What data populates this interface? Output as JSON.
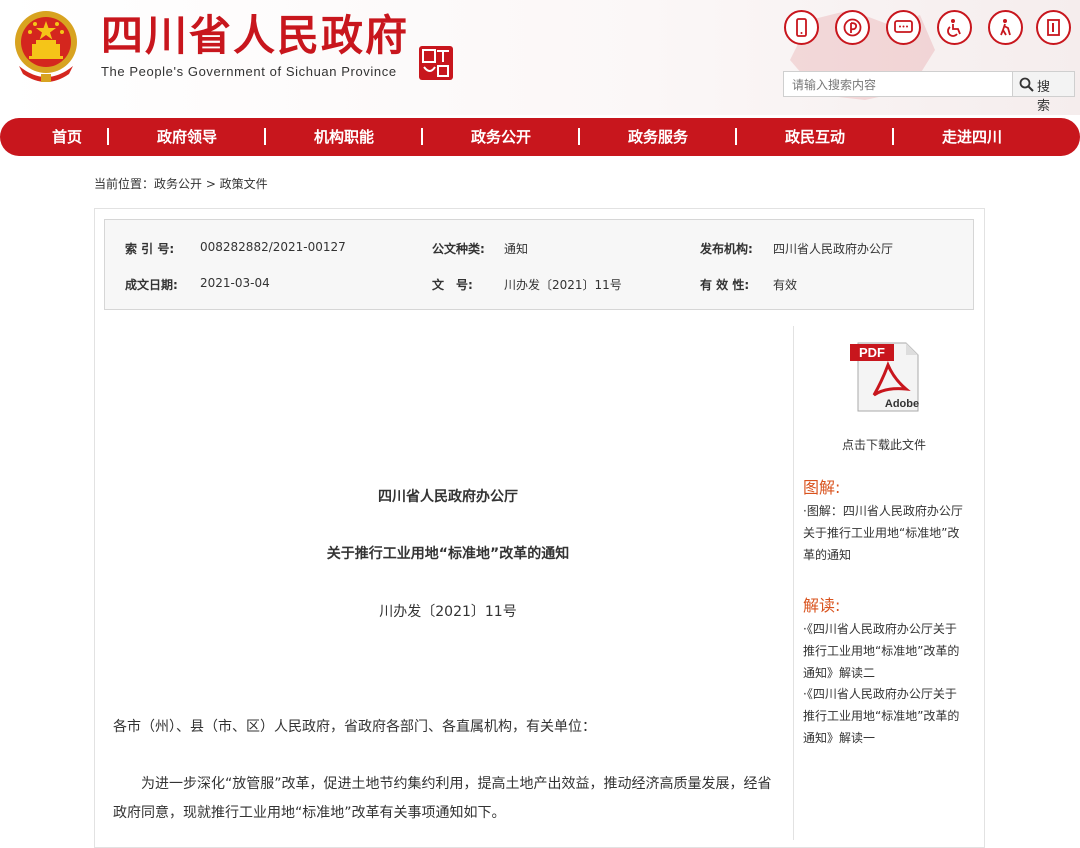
{
  "header": {
    "site_title": "四川省人民政府",
    "site_subtitle": "The People's Government of Sichuan Province",
    "emblem": "national-emblem-icon",
    "seal": "china-seal-icon",
    "tool_icons": [
      "mobile-icon",
      "pinterest-icon",
      "message-icon",
      "accessibility-icon",
      "elderly-icon",
      "exit-icon"
    ],
    "search": {
      "placeholder": "请输入搜索内容",
      "button_label": "搜 索"
    },
    "brand_color": "#c8161d"
  },
  "nav": {
    "items": [
      "首页",
      "政府领导",
      "机构职能",
      "政务公开",
      "政务服务",
      "政民互动",
      "走进四川"
    ],
    "separator": "|"
  },
  "breadcrumb": "当前位置：政务公开 > 政策文件",
  "meta": {
    "index_label": "索 引 号:",
    "index_value": "008282882/2021-00127",
    "type_label": "公文种类:",
    "type_value": "通知",
    "issuer_label": "发布机构:",
    "issuer_value": "四川省人民政府办公厅",
    "date_label": "成文日期:",
    "date_value": "2021-03-04",
    "doc_no_label": "文　号:",
    "doc_no_value": "川办发〔2021〕11号",
    "validity_label": "有 效 性:",
    "validity_value": "有效"
  },
  "sidebar": {
    "pdf_icon": "pdf-adobe-icon",
    "pdf_label": "PDF",
    "pdf_brand": "Adobe",
    "download_label": "点击下载此文件",
    "graphic_heading": "图解:",
    "graphic_link": "·图解：四川省人民政府办公厅关于推行工业用地“标准地”改革的通知",
    "interpret_heading": "解读:",
    "interpret_links": [
      "·《四川省人民政府办公厅关于推行工业用地“标准地”改革的通知》解读二",
      "·《四川省人民政府办公厅关于推行工业用地“标准地”改革的通知》解读一"
    ],
    "accent_color": "#d9531e"
  },
  "document": {
    "org": "四川省人民政府办公厅",
    "title": "关于推行工业用地“标准地”改革的通知",
    "number": "川办发〔2021〕11号",
    "greeting": "各市（州）、县（市、区）人民政府，省政府各部门、各直属机构，有关单位：",
    "body": "为进一步深化“放管服”改革，促进土地节约集约利用，提高土地产出效益，推动经济高质量发展，经省政府同意，现就推行工业用地“标准地”改革有关事项通知如下。"
  }
}
